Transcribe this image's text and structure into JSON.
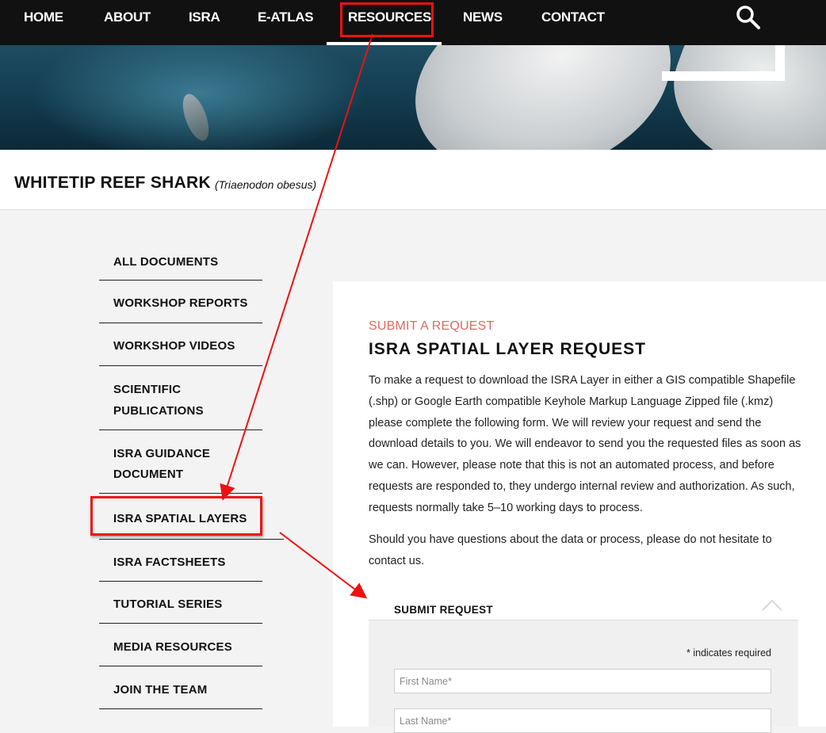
{
  "nav": {
    "items": [
      {
        "label": "HOME"
      },
      {
        "label": "ABOUT"
      },
      {
        "label": "ISRA"
      },
      {
        "label": "E-ATLAS"
      },
      {
        "label": "RESOURCES"
      },
      {
        "label": "NEWS"
      },
      {
        "label": "CONTACT"
      }
    ],
    "active": "RESOURCES",
    "search_icon": "search-icon"
  },
  "species": {
    "name": "WHITETIP REEF SHARK",
    "scientific": "(Triaenodon obesus)"
  },
  "sidebar": {
    "items": [
      {
        "label": "ALL DOCUMENTS"
      },
      {
        "label": "WORKSHOP REPORTS"
      },
      {
        "label": "WORKSHOP VIDEOS"
      },
      {
        "label": "SCIENTIFIC",
        "label2": "PUBLICATIONS"
      },
      {
        "label": "ISRA GUIDANCE",
        "label2": "DOCUMENT"
      },
      {
        "label": "ISRA SPATIAL LAYERS"
      },
      {
        "label": "ISRA FACTSHEETS"
      },
      {
        "label": "TUTORIAL SERIES"
      },
      {
        "label": "MEDIA RESOURCES"
      },
      {
        "label": "JOIN THE TEAM"
      }
    ],
    "active": "ISRA SPATIAL LAYERS"
  },
  "main": {
    "eyebrow": "SUBMIT A REQUEST",
    "title": "ISRA SPATIAL LAYER REQUEST",
    "paragraph1": "To make a request to download the ISRA Layer in either a GIS compatible Shapefile (.shp) or Google Earth compatible Keyhole Markup Language Zipped file (.kmz) please complete the following form. We will review your request and send the download details to you. We will endeavor to send you the requested files as soon as we can. However, please note that this is not an automated process, and before requests are responded to, they undergo internal review and authorization. As such, requests normally take 5–10 working days to process.",
    "paragraph2": "Should you have questions about the data or process, please do not hesitate to contact us.",
    "submit_section": "SUBMIT REQUEST",
    "required_note": "* indicates required",
    "fields": {
      "first_name_placeholder": "First Name*",
      "last_name_placeholder": "Last Name*"
    }
  },
  "colors": {
    "accent": "#e06a5e",
    "highlight": "#e11111",
    "nav_bg": "#111111"
  }
}
